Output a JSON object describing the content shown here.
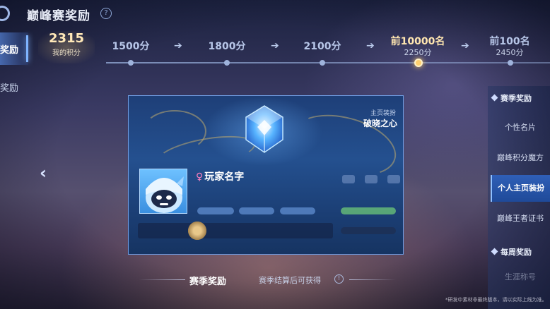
{
  "header": {
    "title": "巅峰赛奖励",
    "help_glyph": "?"
  },
  "left_nav": {
    "items": [
      {
        "label": "奖励",
        "active": true
      },
      {
        "label": "奖励",
        "active": false
      }
    ]
  },
  "score": {
    "value": "2315",
    "label": "我的积分"
  },
  "milestones": [
    {
      "label": "1500分",
      "sub": ""
    },
    {
      "label": "1800分",
      "sub": ""
    },
    {
      "label": "2100分",
      "sub": ""
    },
    {
      "label": "前10000名",
      "sub": "2250分",
      "current": true
    },
    {
      "label": "前100名",
      "sub": "2450分"
    }
  ],
  "reward_card": {
    "item_type": "主页装扮",
    "item_name": "破晓之心",
    "player_name": "玩家名字",
    "gender_glyph": "♀"
  },
  "right_panel": {
    "season_section": "赛季奖励",
    "items": [
      {
        "label": "个性名片",
        "active": false
      },
      {
        "label": "巅峰积分魔方",
        "active": false
      },
      {
        "label": "个人主页装扮",
        "active": true
      },
      {
        "label": "巅峰王者证书",
        "active": false
      }
    ],
    "weekly_section": "每周奖励",
    "faded_item": "生涯称号"
  },
  "footer": {
    "title": "赛季奖励",
    "hint": "赛季结算后可获得",
    "info_glyph": "!",
    "disclaimer": "*研发中素材非最终版本，请以实际上线为准。"
  },
  "icons": {
    "back": "back-icon",
    "prev": "chevron-left-icon",
    "arrow": "arrow-right-icon",
    "crystal": "crystal-cube-icon"
  },
  "colors": {
    "accent_gold": "#ffcf6e",
    "active_blue": "#2f5fb7"
  }
}
